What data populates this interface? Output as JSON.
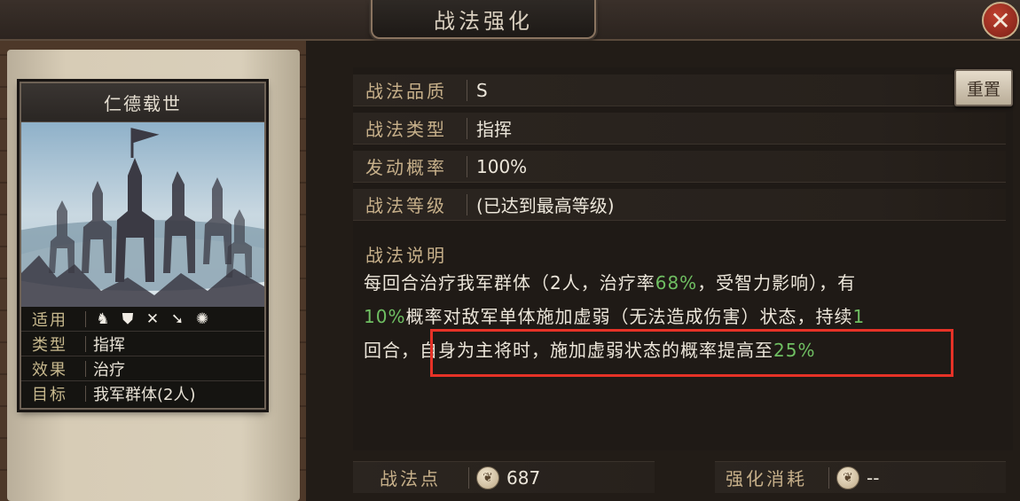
{
  "header": {
    "title": "战法强化",
    "close_label": "✕"
  },
  "card": {
    "name": "仁德载世",
    "info": [
      {
        "label": "适用",
        "value": ""
      },
      {
        "label": "类型",
        "value": "指挥"
      },
      {
        "label": "效果",
        "value": "治疗"
      },
      {
        "label": "目标",
        "value": "我军群体(2人)"
      }
    ],
    "unit_type_icons": [
      "cavalry-icon",
      "shield-icon",
      "bow-icon",
      "spear-icon",
      "wheel-icon"
    ]
  },
  "attributes": [
    {
      "label": "战法品质",
      "value": "S"
    },
    {
      "label": "战法类型",
      "value": "指挥"
    },
    {
      "label": "发动概率",
      "value": "100%"
    },
    {
      "label": "战法等级",
      "value": "(已达到最高等级)"
    }
  ],
  "reset_label": "重置",
  "description": {
    "label": "战法说明",
    "line1_a": "每回合治疗我军群体（2人，治疗率",
    "line1_pct": "68%",
    "line1_b": "，受智力影响），有",
    "line2_pct": "10%",
    "line2_a": "概率对敌军单体施加虚弱（无法造成伤害）状态，持续",
    "line2_num": "1",
    "line3_a": "回合，",
    "line3_b": "自身为主将时，施加虚弱状态的概率提高至",
    "line3_pct": "25%"
  },
  "footer": {
    "points_label": "战法点",
    "points_value": "687",
    "cost_label": "强化消耗",
    "cost_value": "--"
  },
  "colors": {
    "highlight": "#e63227",
    "accent_green": "#6fbf62",
    "gold_label": "#c7b08a"
  }
}
